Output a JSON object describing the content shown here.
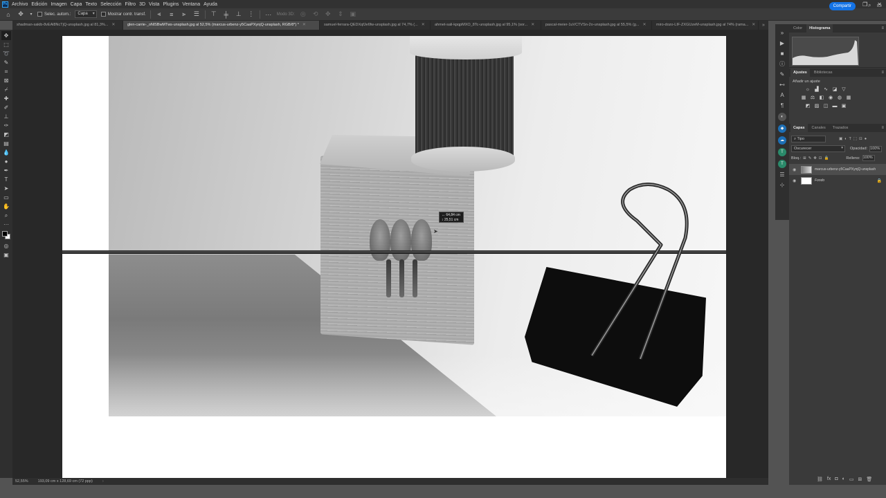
{
  "menu": {
    "logo": "Ps",
    "items": [
      "Archivo",
      "Edición",
      "Imagen",
      "Capa",
      "Texto",
      "Selección",
      "Filtro",
      "3D",
      "Vista",
      "Plugins",
      "Ventana",
      "Ayuda"
    ]
  },
  "options": {
    "auto_select_label": "Selec. autom.:",
    "auto_select_target": "Capa",
    "show_transform_label": "Mostrar contr. transf.",
    "mode_3d_label": "Modo 3D:",
    "share_label": "Compartir"
  },
  "tabs": [
    {
      "label": "shadman-sakib-8vEAl8NcTjQ-unsplash.jpg al 81,3%...",
      "active": false
    },
    {
      "label": "glen-carrie-_oNlSBwMTws-unsplash.jpg al 52,5% (marcus-urbenz-y5CaaPXynjQ-unsplash, RGB/8*) *",
      "active": true
    },
    {
      "label": "samuel-ferrara-QEDXqfJe6fw-unsplash.jpg al 74,7% (...",
      "active": false
    },
    {
      "label": "ahmet-sali-kpqpMXO_8Tc-unsplash.jpg al 95,1% (sor...",
      "active": false
    },
    {
      "label": "pascal-meier-1uVCTVSn-2o-unsplash.jpg al 55,5% (g...",
      "active": false
    },
    {
      "label": "miro-dozo-LIF-ZXGUzeM-unsplash.jpg al 74% (rama...",
      "active": false
    }
  ],
  "measure": {
    "width": "↔ 64,84 cm",
    "height": "↕ 25,51 cm"
  },
  "status": {
    "zoom": "52,55%",
    "doc_size": "193,09 cm x 128,69 cm (72 ppp)"
  },
  "panels": {
    "top_tabs": [
      "Color",
      "Histograma"
    ],
    "adjust_tabs": [
      "Ajustes",
      "Bibliotecas"
    ],
    "adjust_hint": "Añadir un ajuste",
    "layer_tabs": [
      "Capas",
      "Canales",
      "Trazados"
    ],
    "layer_filter": "Tipo",
    "blend_mode": "Oscurecer",
    "opacity_label": "Opacidad:",
    "opacity_value": "100%",
    "lock_label": "Bloq.:",
    "fill_label": "Relleno:",
    "fill_value": "100%",
    "layers": [
      {
        "name": "marcus-urbenz-y5CaaPXynjQ-unsplash",
        "selected": true,
        "locked": false
      },
      {
        "name": "Fondo",
        "selected": false,
        "locked": true
      }
    ]
  },
  "colors": {
    "accent": "#1473e6",
    "foreground": "#000000",
    "background": "#ffffff"
  }
}
